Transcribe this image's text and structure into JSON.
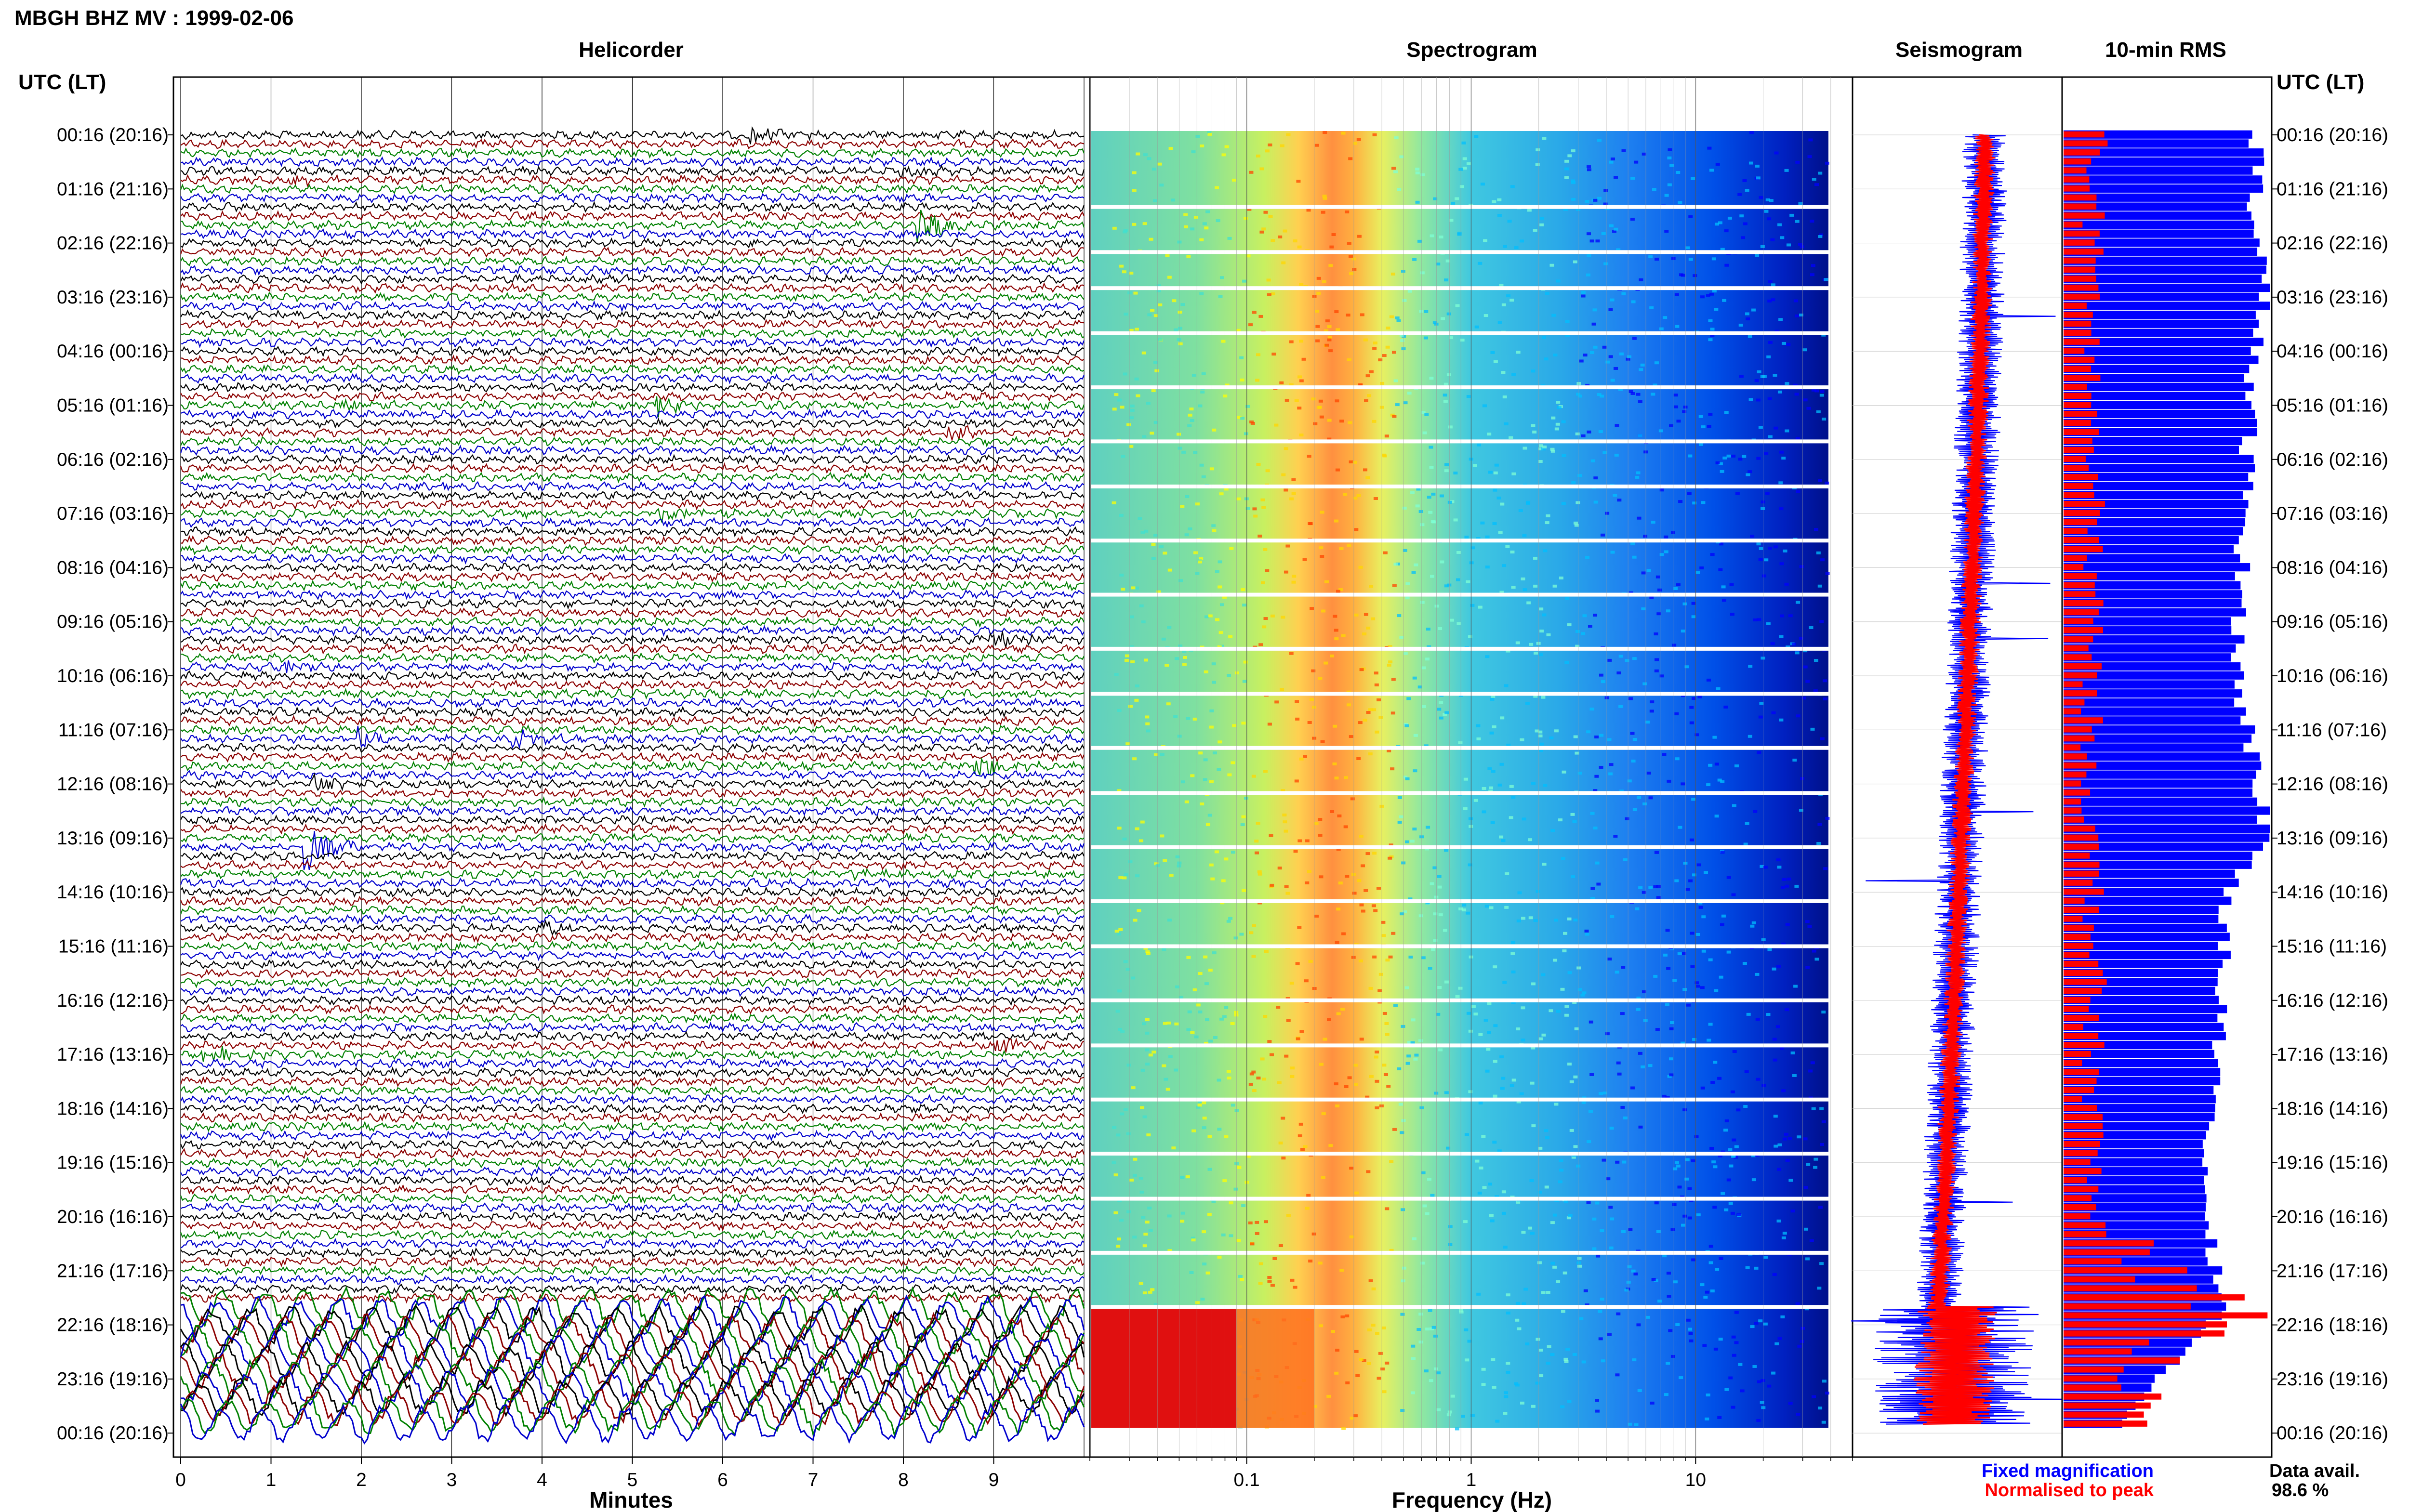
{
  "header": {
    "title": "MBGH BHZ MV : 1999-02-06"
  },
  "panels": {
    "helicorder_title": "Helicorder",
    "spectrogram_title": "Spectrogram",
    "seismogram_title": "Seismogram",
    "rms_title": "10-min RMS"
  },
  "time_axis_label": "UTC (LT)",
  "time_axis_label_right": "UTC (LT)",
  "time_ticks": [
    "00:16 (20:16)",
    "01:16 (21:16)",
    "02:16 (22:16)",
    "03:16 (23:16)",
    "04:16 (00:16)",
    "05:16 (01:16)",
    "06:16 (02:16)",
    "07:16 (03:16)",
    "08:16 (04:16)",
    "09:16 (05:16)",
    "10:16 (06:16)",
    "11:16 (07:16)",
    "12:16 (08:16)",
    "13:16 (09:16)",
    "14:16 (10:16)",
    "15:16 (11:16)",
    "16:16 (12:16)",
    "17:16 (13:16)",
    "18:16 (14:16)",
    "19:16 (15:16)",
    "20:16 (16:16)",
    "21:16 (17:16)",
    "22:16 (18:16)",
    "23:16 (19:16)",
    "00:16 (20:16)"
  ],
  "legend": {
    "fixed": "Fixed magnification",
    "normalised": "Normalised to peak",
    "fixed_color": "#0000ff",
    "normalised_color": "#ff0000"
  },
  "data_avail": {
    "label": "Data avail.",
    "value": "98.6 %"
  },
  "chart_data": [
    {
      "type": "line",
      "panel": "Helicorder",
      "xlabel": "Minutes",
      "x_ticks": [
        "0",
        "1",
        "2",
        "3",
        "4",
        "5",
        "6",
        "7",
        "8",
        "9"
      ],
      "xlim": [
        0,
        10
      ],
      "trace_colors": [
        "#000000",
        "#8b0000",
        "#008000",
        "#0000cd"
      ],
      "rows_per_hour": 6,
      "events": [
        {
          "row": 0,
          "minute": 6.3,
          "strength": 3,
          "color": "#8b0000"
        },
        {
          "row": 4,
          "minute": 8.0,
          "strength": 2,
          "color": "#000000"
        },
        {
          "row": 5,
          "minute": 1.2,
          "strength": 2,
          "color": "#8b0000"
        },
        {
          "row": 10,
          "minute": 8.2,
          "strength": 6,
          "color": "#0000cd"
        },
        {
          "row": 30,
          "minute": 1.8,
          "strength": 2,
          "color": "#000000"
        },
        {
          "row": 30,
          "minute": 5.3,
          "strength": 3,
          "color": "#000000"
        },
        {
          "row": 33,
          "minute": 8.5,
          "strength": 2,
          "color": "#0000cd"
        },
        {
          "row": 42,
          "minute": 5.3,
          "strength": 3,
          "color": "#000000"
        },
        {
          "row": 56,
          "minute": 9.0,
          "strength": 3,
          "color": "#8b0000"
        },
        {
          "row": 59,
          "minute": 1.2,
          "strength": 2,
          "color": "#0000cd"
        },
        {
          "row": 67,
          "minute": 2.0,
          "strength": 3,
          "color": "#000000"
        },
        {
          "row": 67,
          "minute": 3.7,
          "strength": 3,
          "color": "#000000"
        },
        {
          "row": 70,
          "minute": 8.8,
          "strength": 4,
          "color": "#8b0000"
        },
        {
          "row": 72,
          "minute": 1.5,
          "strength": 3,
          "color": "#008000"
        },
        {
          "row": 79,
          "minute": 1.4,
          "strength": 8,
          "color": "#008000"
        },
        {
          "row": 82,
          "minute": 7.5,
          "strength": 2,
          "color": "#000000"
        },
        {
          "row": 88,
          "minute": 4.0,
          "strength": 2,
          "color": "#000000"
        },
        {
          "row": 101,
          "minute": 9.0,
          "strength": 3,
          "color": "#8b0000"
        },
        {
          "row": 102,
          "minute": 0.3,
          "strength": 3,
          "color": "#8b0000"
        }
      ],
      "high_noise_from_row": 130
    },
    {
      "type": "heatmap",
      "panel": "Spectrogram",
      "xlabel": "Frequency (Hz)",
      "x_scale": "log",
      "xlim": [
        0.02,
        50
      ],
      "x_ticks": [
        "0.1",
        "1",
        "10"
      ],
      "x_tick_values": [
        0.1,
        1,
        10
      ],
      "colormap": [
        "#00008b",
        "#0000ff",
        "#1e90ff",
        "#00bfff",
        "#40e0d0",
        "#7fffd4",
        "#adff2f",
        "#ffff00",
        "#ffa500",
        "#ff4500",
        "#b22222",
        "#8b0000"
      ],
      "peak_band_hz": [
        0.17,
        0.4
      ],
      "data_upper_hz": 40,
      "gap_rows": [
        8,
        13,
        17,
        22,
        28,
        34,
        39,
        45,
        51,
        57,
        62,
        68,
        73,
        79,
        85,
        90,
        96,
        101,
        107,
        113,
        118,
        124,
        130
      ]
    },
    {
      "type": "line",
      "panel": "Seismogram",
      "series": [
        {
          "name": "Fixed magnification",
          "color": "#0000ff"
        },
        {
          "name": "Normalised to peak",
          "color": "#ff0000"
        }
      ]
    },
    {
      "type": "bar",
      "panel": "10-min RMS",
      "orientation": "horizontal",
      "series": [
        {
          "name": "Fixed magnification",
          "color": "#0000ff"
        },
        {
          "name": "Normalised to peak",
          "color": "#ff0000"
        }
      ],
      "xlim": [
        0,
        1
      ],
      "rms_profile": [
        {
          "row": 0,
          "blue": 0.95,
          "red": 0.16
        },
        {
          "row": 12,
          "blue": 0.93,
          "red": 0.14
        },
        {
          "row": 18,
          "blue": 1.0,
          "red": 0.15
        },
        {
          "row": 24,
          "blue": 0.92,
          "red": 0.14
        },
        {
          "row": 36,
          "blue": 0.9,
          "red": 0.14
        },
        {
          "row": 48,
          "blue": 0.87,
          "red": 0.15
        },
        {
          "row": 60,
          "blue": 0.85,
          "red": 0.14
        },
        {
          "row": 78,
          "blue": 1.0,
          "red": 0.13
        },
        {
          "row": 84,
          "blue": 0.8,
          "red": 0.15
        },
        {
          "row": 96,
          "blue": 0.77,
          "red": 0.15
        },
        {
          "row": 102,
          "blue": 0.75,
          "red": 0.14
        },
        {
          "row": 108,
          "blue": 0.72,
          "red": 0.15
        },
        {
          "row": 120,
          "blue": 0.68,
          "red": 0.14
        },
        {
          "row": 130,
          "blue": 0.8,
          "red": 0.75
        },
        {
          "row": 136,
          "blue": 0.55,
          "red": 0.5
        },
        {
          "row": 142,
          "blue": 0.3,
          "red": 0.3
        }
      ]
    }
  ]
}
